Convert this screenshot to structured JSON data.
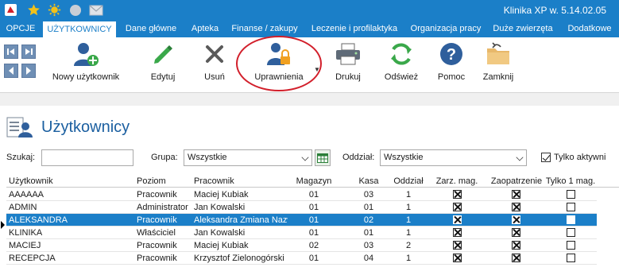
{
  "app": {
    "title": "Klinika XP w. 5.14.02.05"
  },
  "titlebar_icons": [
    "app-logo-icon",
    "star-icon",
    "sun-icon",
    "circle-icon",
    "mail-icon"
  ],
  "tabs": [
    {
      "label": "OPCJE"
    },
    {
      "label": "UŻYTKOWNICY",
      "active": true
    },
    {
      "label": "Dane główne"
    },
    {
      "label": "Apteka"
    },
    {
      "label": "Finanse / zakupy"
    },
    {
      "label": "Leczenie i profilaktyka"
    },
    {
      "label": "Organizacja pracy"
    },
    {
      "label": "Duże zwierzęta"
    },
    {
      "label": "Dodatkowe"
    }
  ],
  "toolbar": {
    "new_user": "Nowy użytkownik",
    "edit": "Edytuj",
    "delete": "Usuń",
    "permissions": "Uprawnienia",
    "print": "Drukuj",
    "refresh": "Odśwież",
    "help": "Pomoc",
    "close": "Zamknij"
  },
  "page": {
    "title": "Użytkownicy"
  },
  "filters": {
    "search_label": "Szukaj:",
    "search_value": "",
    "group_label": "Grupa:",
    "group_value": "Wszystkie",
    "branch_label": "Oddział:",
    "branch_value": "Wszystkie",
    "active_only_label": "Tylko aktywni",
    "active_only_checked": true
  },
  "table": {
    "columns": [
      "Użytkownik",
      "Poziom",
      "Pracownik",
      "Magazyn",
      "Kasa",
      "Oddział",
      "Zarz. mag.",
      "Zaopatrzenie",
      "Tylko 1 mag."
    ],
    "rows": [
      {
        "user": "AAAAAA",
        "level": "Pracownik",
        "employee": "Maciej Kubiak",
        "warehouse": "01",
        "cash": "03",
        "branch": "1",
        "mgmt": true,
        "supply": true,
        "single": false
      },
      {
        "user": "ADMIN",
        "level": "Administrator",
        "employee": "Jan Kowalski",
        "warehouse": "01",
        "cash": "01",
        "branch": "1",
        "mgmt": true,
        "supply": true,
        "single": false
      },
      {
        "user": "ALEKSANDRA",
        "level": "Pracownik",
        "employee": "Aleksandra Zmiana Nazwi",
        "warehouse": "01",
        "cash": "02",
        "branch": "1",
        "mgmt": true,
        "supply": true,
        "single": false,
        "selected": true
      },
      {
        "user": "KLINIKA",
        "level": "Właściciel",
        "employee": "Jan Kowalski",
        "warehouse": "01",
        "cash": "01",
        "branch": "1",
        "mgmt": true,
        "supply": true,
        "single": false
      },
      {
        "user": "MACIEJ",
        "level": "Pracownik",
        "employee": "Maciej Kubiak",
        "warehouse": "02",
        "cash": "03",
        "branch": "2",
        "mgmt": true,
        "supply": true,
        "single": false
      },
      {
        "user": "RECEPCJA",
        "level": "Pracownik",
        "employee": "Krzysztof Zielonogórski",
        "warehouse": "01",
        "cash": "04",
        "branch": "1",
        "mgmt": true,
        "supply": true,
        "single": false
      }
    ]
  },
  "colors": {
    "accent": "#1b7fc8",
    "highlight": "#d21f2b",
    "title": "#1b5fa0"
  }
}
